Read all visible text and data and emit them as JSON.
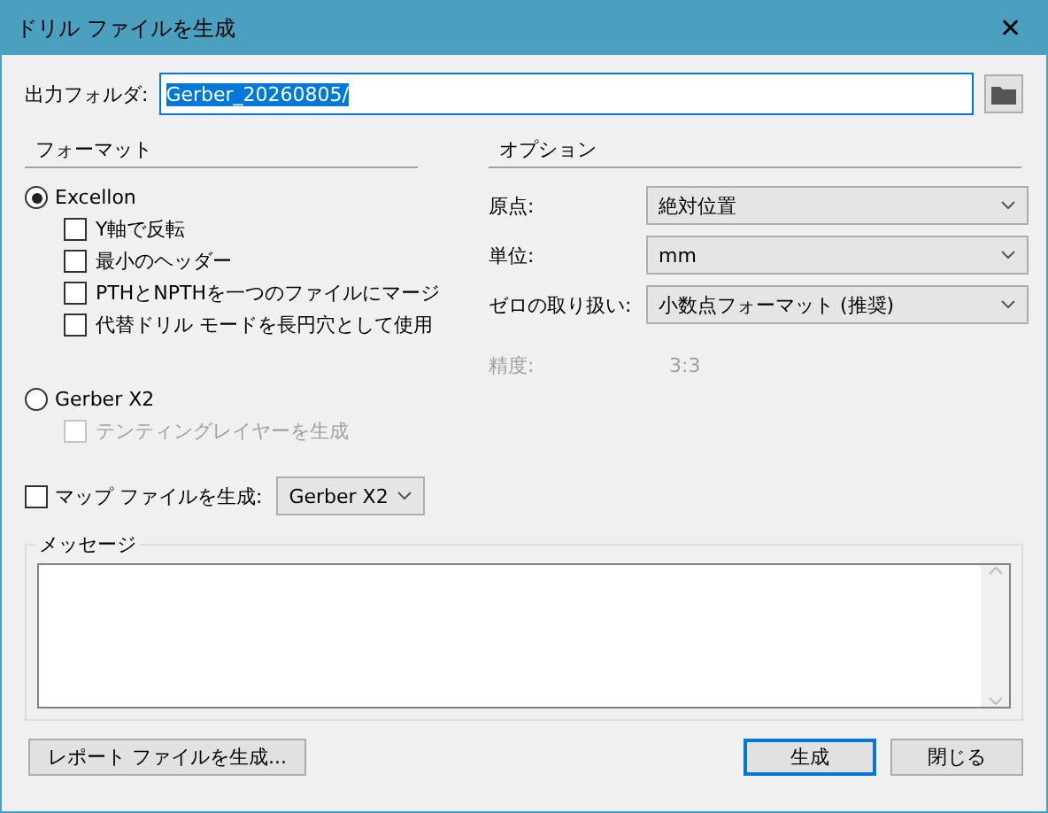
{
  "window": {
    "title": "ドリル ファイルを生成",
    "close": "✕"
  },
  "output_folder": {
    "label": "出力フォルダ:",
    "value": "Gerber_20260805/",
    "selected_text": true
  },
  "format": {
    "heading": "フォーマット",
    "choices": [
      {
        "label": "Excellon",
        "selected": true,
        "options": [
          {
            "label": "Y軸で反転",
            "checked": false,
            "disabled": false
          },
          {
            "label": "最小のヘッダー",
            "checked": false,
            "disabled": false
          },
          {
            "label": "PTHとNPTHを一つのファイルにマージ",
            "checked": false,
            "disabled": false
          },
          {
            "label": "代替ドリル モードを長円穴として使用",
            "checked": false,
            "disabled": false
          }
        ]
      },
      {
        "label": "Gerber X2",
        "selected": false,
        "options": [
          {
            "label": "テンティングレイヤーを生成",
            "checked": false,
            "disabled": true
          }
        ]
      }
    ],
    "map_file": {
      "label": "マップ ファイルを生成:",
      "checked": false,
      "value": "Gerber X2"
    }
  },
  "options": {
    "heading": "オプション",
    "fields": [
      {
        "label": "原点:",
        "value": "絶対位置"
      },
      {
        "label": "単位:",
        "value": "mm"
      },
      {
        "label": "ゼロの取り扱い:",
        "value": "小数点フォーマット (推奨)"
      }
    ],
    "precision": {
      "label": "精度:",
      "value": "3:3",
      "disabled": true
    }
  },
  "messages": {
    "heading": "メッセージ"
  },
  "buttons": [
    {
      "label": "レポート ファイルを生成...",
      "default": false
    },
    {
      "label": "生成",
      "default": true
    },
    {
      "label": "閉じる",
      "default": false
    }
  ]
}
